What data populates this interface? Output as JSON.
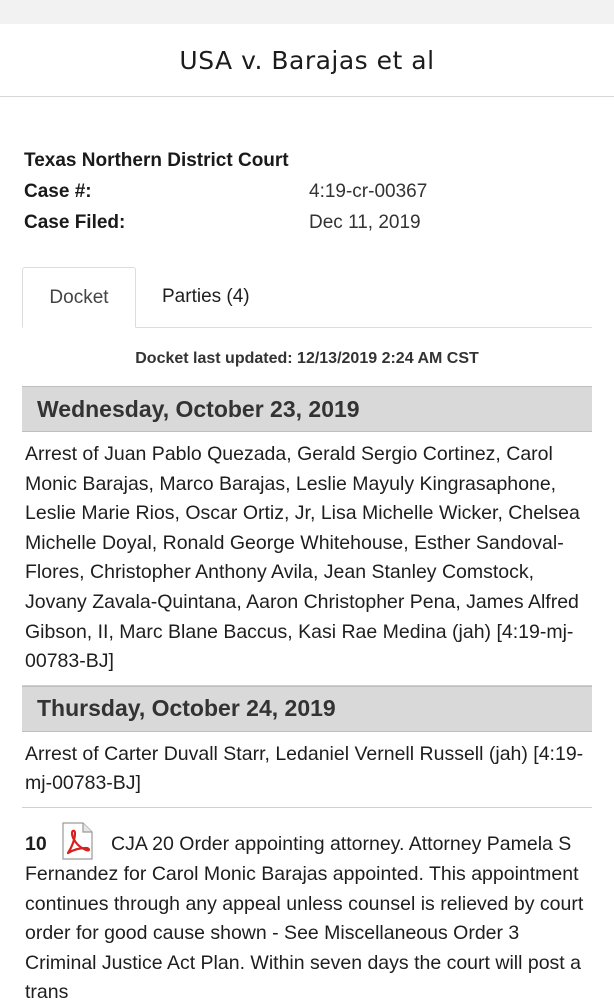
{
  "header": {
    "title": "USA v. Barajas et al"
  },
  "case": {
    "court": "Texas Northern District Court",
    "case_number_label": "Case #:",
    "case_number": "4:19-cr-00367",
    "filed_label": "Case Filed:",
    "filed_date": "Dec 11, 2019"
  },
  "tabs": [
    {
      "label": "Docket",
      "active": true
    },
    {
      "label": "Parties (4)",
      "active": false
    }
  ],
  "docket": {
    "last_updated": "Docket last updated: 12/13/2019 2:24 AM CST",
    "days": [
      {
        "date": "Wednesday, October 23, 2019",
        "entries": [
          {
            "number": "",
            "text": " Arrest of Juan Pablo Quezada, Gerald Sergio Cortinez, Carol Monic Barajas, Marco Barajas, Leslie Mayuly Kingrasaphone, Leslie Marie Rios, Oscar Ortiz, Jr, Lisa Michelle Wicker, Chelsea Michelle Doyal, Ronald George Whitehouse, Esther Sandoval-Flores, Christopher Anthony Avila, Jean Stanley Comstock, Jovany Zavala-Quintana, Aaron Christopher Pena, James Alfred Gibson, II, Marc Blane Baccus, Kasi Rae Medina (jah) [4:19-mj-00783-BJ]"
          }
        ]
      },
      {
        "date": "Thursday, October 24, 2019",
        "entries": [
          {
            "number": "",
            "text": " Arrest of Carter Duvall Starr, Ledaniel Vernell Russell (jah) [4:19-mj-00783-BJ]"
          },
          {
            "number": "10",
            "icon": "pdf-icon",
            "text": "CJA 20 Order appointing attorney. Attorney Pamela S Fernandez for Carol Monic Barajas appointed. This appointment continues through any appeal unless counsel is relieved by court order for good cause shown - See Miscellaneous Order 3 Criminal Justice Act Plan. Within seven days the court will post a trans"
          }
        ]
      }
    ]
  },
  "colors": {
    "day_header_bg": "#d9d9d9",
    "pdf_red": "#d6211f"
  }
}
